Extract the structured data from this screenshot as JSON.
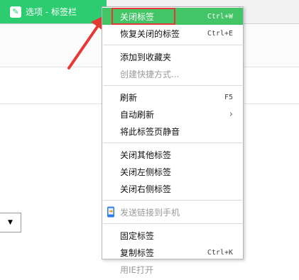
{
  "browser": {
    "active_tab_label": "选项 - 标签栏",
    "active_tab_icon": "wrench-icon"
  },
  "menu": {
    "close_tab": {
      "label": "关闭标签",
      "shortcut": "Ctrl+W"
    },
    "restore_closed_tab": {
      "label": "恢复关闭的标签",
      "shortcut": "Ctrl+E"
    },
    "add_to_favorites": {
      "label": "添加到收藏夹"
    },
    "create_shortcut": {
      "label": "创建快捷方式..."
    },
    "refresh": {
      "label": "刷新",
      "shortcut": "F5"
    },
    "auto_refresh": {
      "label": "自动刷新",
      "submenu_icon": "chevron-right-icon"
    },
    "mute_tab": {
      "label": "将此标签页静音"
    },
    "close_other_tabs": {
      "label": "关闭其他标签"
    },
    "close_left_tabs": {
      "label": "关闭左侧标签"
    },
    "close_right_tabs": {
      "label": "关闭右侧标签"
    },
    "send_link_to_phone": {
      "label": "发送链接到手机",
      "icon": "phone-send-icon"
    },
    "pin_tab": {
      "label": "固定标签"
    },
    "duplicate_tab": {
      "label": "复制标签",
      "shortcut": "Ctrl+K"
    },
    "open_with_ie": {
      "label": "用IE打开"
    }
  },
  "colors": {
    "highlight": "#43c467",
    "tab_green": "#2ecc71",
    "annotation_red": "#e53935",
    "disabled_text": "#9a9a9a"
  }
}
